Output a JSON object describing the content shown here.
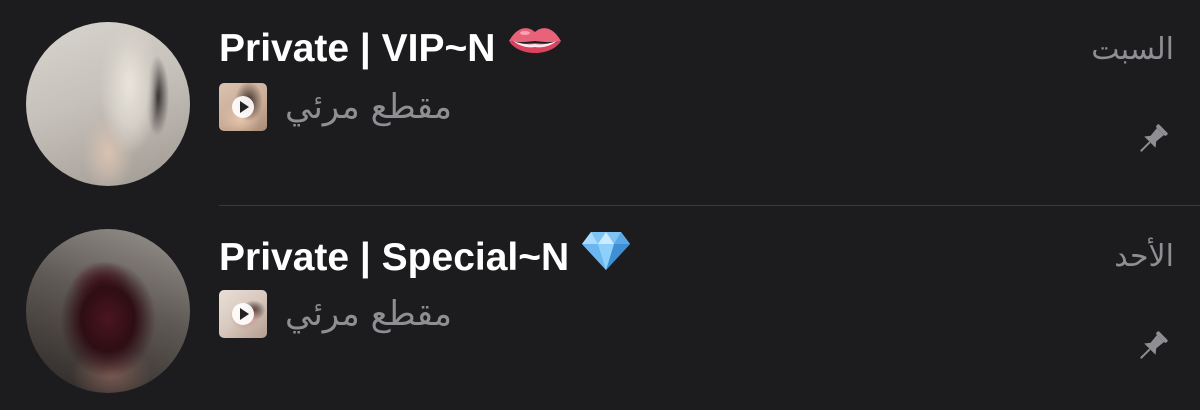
{
  "chats": [
    {
      "title": "Private | VIP~N",
      "emoji": "lips-emoji",
      "preview_icon": "video-thumbnail-icon",
      "preview_text": "مقطع مرئي",
      "date": "السبت",
      "pinned": true,
      "pin_icon": "pin-icon"
    },
    {
      "title": "Private | Special~N",
      "emoji": "gem-emoji",
      "preview_icon": "video-thumbnail-icon",
      "preview_text": "مقطع مرئي",
      "date": "الأحد",
      "pinned": true,
      "pin_icon": "pin-icon"
    }
  ],
  "colors": {
    "background": "#1c1c1e",
    "title": "#ffffff",
    "secondary": "#8e8e93",
    "separator": "#3a3a3c",
    "gem": "#7fc4f3",
    "lips": "#e8627a"
  }
}
